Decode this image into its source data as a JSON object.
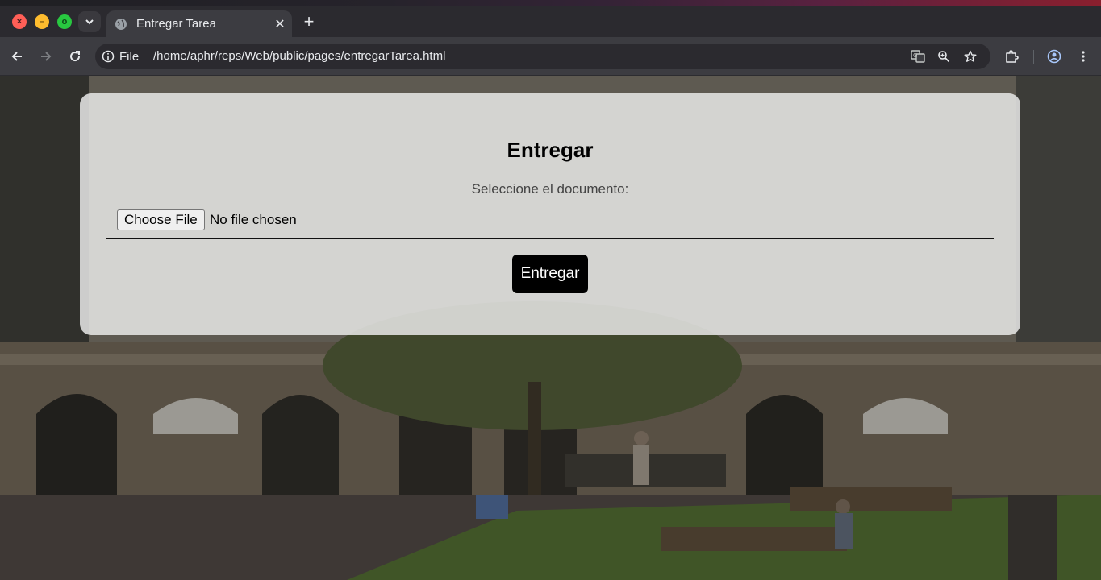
{
  "browser": {
    "tab": {
      "title": "Entregar Tarea"
    },
    "address_bar": {
      "scheme_label": "File",
      "url": "/home/aphr/reps/Web/public/pages/entregarTarea.html"
    },
    "icons": {
      "back": "back-arrow-icon",
      "forward": "forward-arrow-icon",
      "reload": "reload-icon",
      "translate": "translate-icon",
      "zoom": "zoom-icon",
      "bookmark": "star-icon",
      "extensions": "puzzle-icon",
      "profile": "profile-icon",
      "menu": "kebab-menu-icon"
    }
  },
  "page": {
    "heading": "Entregar",
    "prompt": "Seleccione el documento:",
    "file_input": {
      "button_label": "Choose File",
      "status": "No file chosen"
    },
    "submit_label": "Entregar"
  },
  "colors": {
    "card_bg": "#e8e8e6",
    "submit_bg": "#000000",
    "toolbar_bg": "#3c3c41"
  }
}
